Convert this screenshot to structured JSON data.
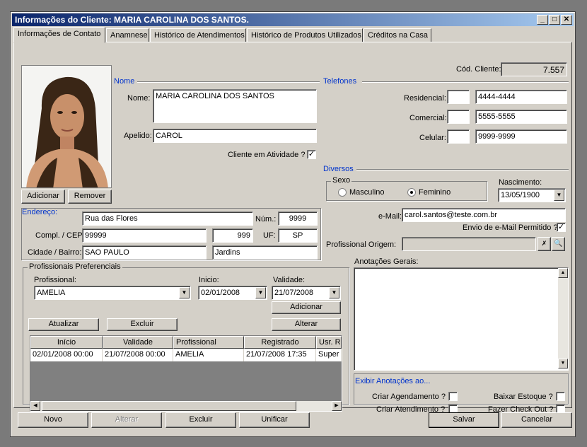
{
  "window": {
    "title": "Informações do Cliente: MARIA CAROLINA DOS SANTOS."
  },
  "tabs": [
    "Informações de Contato",
    "Anamnese",
    "Histórico de Atendimentos",
    "Histórico de Produtos Utilizados",
    "Créditos na Casa"
  ],
  "client": {
    "code_label": "Cód. Cliente:",
    "code": "7.557",
    "section_nome": "Nome",
    "nome_label": "Nome:",
    "nome": "MARIA CAROLINA DOS SANTOS",
    "apelido_label": "Apelido:",
    "apelido": "CAROL",
    "ativo_label": "Cliente em Atividade ?",
    "ativo": "✓"
  },
  "photo_buttons": {
    "add": "Adicionar",
    "remove": "Remover"
  },
  "phones": {
    "title": "Telefones",
    "res_label": "Residencial:",
    "res": "4444-4444",
    "com_label": "Comercial:",
    "com": "5555-5555",
    "cel_label": "Celular:",
    "cel": "9999-9999"
  },
  "diversos": {
    "title": "Diversos",
    "sexo_label": "Sexo",
    "masc": "Masculino",
    "fem": "Feminino",
    "nasc_label": "Nascimento:",
    "nasc": "13/05/1900",
    "email_label": "e-Mail:",
    "email": "carol.santos@teste.com.br",
    "envio_label": "Envio de e-Mail Permitido ?",
    "envio": "✓",
    "prof_origem_label": "Profissional Origem:"
  },
  "endereco": {
    "title": "Endereço:",
    "rua": "Rua das Flores",
    "num_label": "Núm.:",
    "num": "9999",
    "compl_label": "Compl. / CEP:",
    "compl": "99999",
    "cep": "999",
    "uf_label": "UF:",
    "uf": "SP",
    "cidade_label": "Cidade / Bairro:",
    "cidade": "SAO PAULO",
    "bairro": "Jardins"
  },
  "prof_pref": {
    "title": "Profissionais Preferenciais",
    "prof_label": "Profissional:",
    "prof": "AMELIA",
    "inicio_label": "Inicio:",
    "inicio": "02/01/2008",
    "validade_label": "Validade:",
    "validade": "21/07/2008",
    "btn_adicionar": "Adicionar",
    "btn_atualizar": "Atualizar",
    "btn_excluir": "Excluir",
    "btn_alterar": "Alterar",
    "columns": [
      "Início",
      "Validade",
      "Profissional",
      "Registrado",
      "Usr. Re"
    ],
    "row": [
      "02/01/2008 00:00",
      "21/07/2008 00:00",
      "AMELIA",
      "21/07/2008 17:35",
      "Super U"
    ]
  },
  "anotacoes": {
    "title": "Anotações Gerais:",
    "exibir": "Exibir Anotações ao...",
    "criar_ag": "Criar Agendamento ?",
    "criar_at": "Criar Atendimento ?",
    "baixar": "Baixar Estoque ?",
    "checkout": "Fazer Check Out ?"
  },
  "footer": {
    "novo": "Novo",
    "alterar": "Alterar",
    "excluir": "Excluir",
    "unificar": "Unificar",
    "salvar": "Salvar",
    "cancelar": "Cancelar"
  }
}
